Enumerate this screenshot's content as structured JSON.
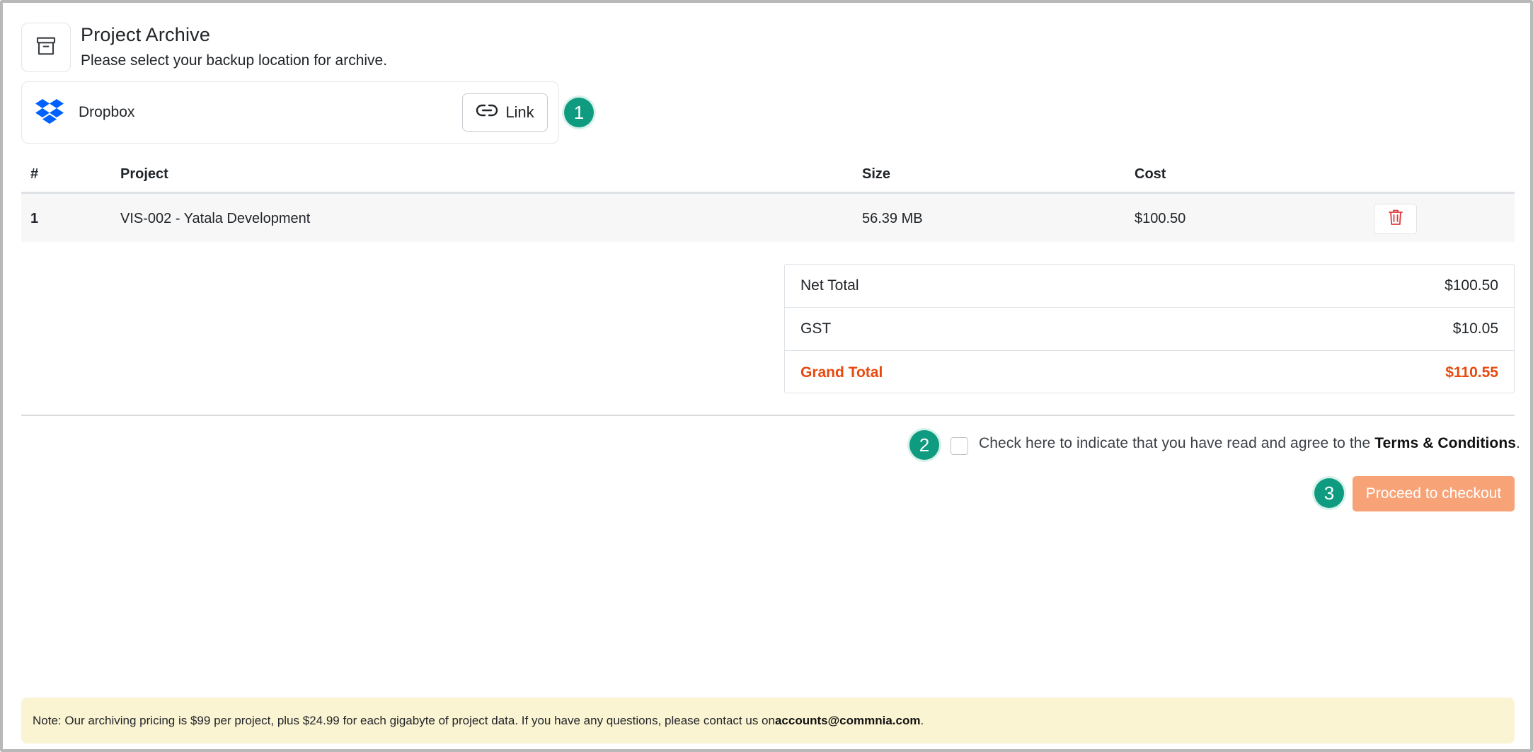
{
  "header": {
    "icon": "archive-box-icon",
    "title": "Project Archive",
    "subtitle": "Please select your backup location for archive."
  },
  "backup": {
    "provider_icon": "dropbox-logo",
    "provider_name": "Dropbox",
    "link_icon": "link-icon",
    "link_label": "Link"
  },
  "steps": [
    "1",
    "2",
    "3"
  ],
  "table": {
    "headers": [
      "#",
      "Project",
      "Size",
      "Cost"
    ],
    "rows": [
      {
        "num": "1",
        "project": "VIS-002 - Yatala Development",
        "size": "56.39 MB",
        "cost": "$100.50",
        "action_icon": "trash-icon"
      }
    ]
  },
  "totals": {
    "net_label": "Net Total",
    "net_value": "$100.50",
    "gst_label": "GST",
    "gst_value": "$10.05",
    "grand_label": "Grand Total",
    "grand_value": "$110.55"
  },
  "terms": {
    "text": "Check here to indicate that you have read and agree to the ",
    "link": "Terms & Conditions",
    "suffix": ".",
    "checked": false
  },
  "checkout": {
    "label": "Proceed to checkout"
  },
  "note": {
    "text": "Note: Our archiving pricing is $99 per project, plus $24.99 for each gigabyte of project data. If you have any questions, please contact us on ",
    "email": "accounts@commnia.com",
    "suffix": "."
  },
  "colors": {
    "accent_orange": "#e8490e",
    "checkout_button": "#f8a377",
    "step_badge": "#0f9b80",
    "delete_icon": "#e03c3c",
    "note_background": "#fbf4d3",
    "dropbox_blue": "#0061fe"
  }
}
